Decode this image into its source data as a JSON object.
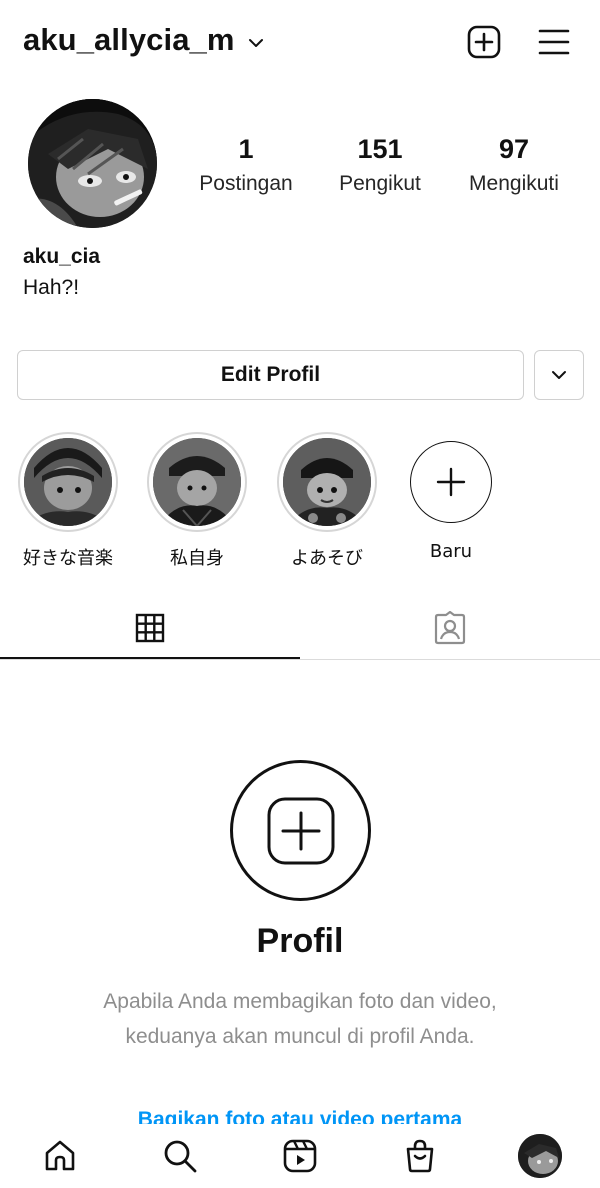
{
  "header": {
    "username": "aku_allycia_m",
    "icons": [
      "chevron-down-icon",
      "new-post-icon",
      "menu-icon"
    ]
  },
  "profile": {
    "stats": [
      {
        "value": "1",
        "label": "Postingan"
      },
      {
        "value": "151",
        "label": "Pengikut"
      },
      {
        "value": "97",
        "label": "Mengikuti"
      }
    ],
    "name": "aku_cia",
    "bio": "Hah?!"
  },
  "actions": {
    "edit_label": "Edit Profil"
  },
  "highlights": [
    {
      "label": "好きな音楽"
    },
    {
      "label": "私自身"
    },
    {
      "label": "よあそび"
    },
    {
      "label": "Baru"
    }
  ],
  "tabs": {
    "icons": [
      "grid-icon",
      "tagged-icon"
    ],
    "active": "grid"
  },
  "empty_state": {
    "title": "Profil",
    "description": "Apabila Anda membagikan foto dan video, keduanya akan muncul di profil Anda.",
    "link": "Bagikan foto atau video pertama"
  },
  "bottom_nav": {
    "icons": [
      "home-icon",
      "search-icon",
      "reels-icon",
      "shop-icon",
      "profile-avatar"
    ]
  },
  "colors": {
    "text": "#111111",
    "muted": "#8e8e8e",
    "link": "#0095f6",
    "border": "#dbdbdb"
  }
}
